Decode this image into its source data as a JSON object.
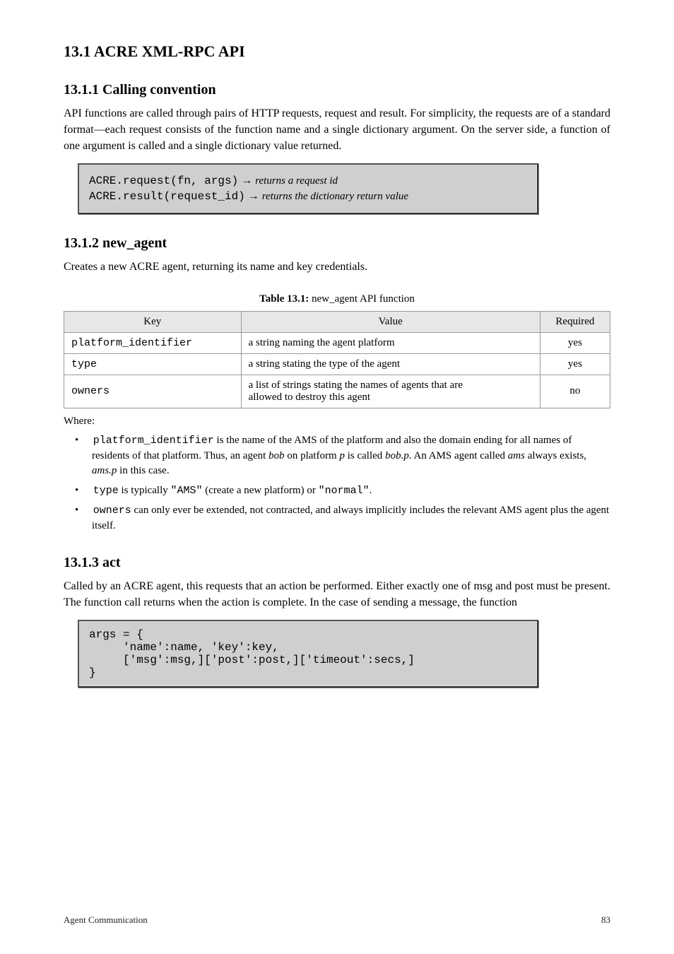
{
  "section_13_1": {
    "title": "13.1 ACRE XML-RPC API",
    "subsections": {
      "calling_convention": {
        "heading": "13.1.1 Calling convention",
        "paragraph": "API functions are called through pairs of HTTP requests, request and result. For simplicity, the requests are of a standard format—each request consists of the function name and a single dictionary argument. On the server side, a function of one argument is called and a single dictionary value returned.",
        "panel": {
          "line1_lhs": "ACRE.request(fn, args)",
          "line1_arrow": "→",
          "line1_rhs": "returns a request id",
          "line2_lhs": "ACRE.result(request_id)",
          "line2_arrow": "→",
          "line2_rhs": "returns the dictionary return value"
        }
      },
      "new_agent": {
        "heading": "13.1.2 new_agent",
        "paragraph": "Creates a new ACRE agent, returning its name and key credentials.",
        "table_caption_label": "Table 13.1:",
        "table_caption_text": "new_agent API function",
        "table": {
          "headers": [
            "Key",
            "Value",
            "Required"
          ],
          "rows": [
            {
              "key": "platform_identifier",
              "value": "a string naming the agent platform",
              "required": "yes"
            },
            {
              "key": "type",
              "value": "a string stating the type of the agent",
              "required": "yes"
            },
            {
              "key": "owners",
              "value_line1": "a list of strings stating the names of agents that are",
              "value_line2": "allowed to destroy this agent",
              "required": "no"
            }
          ]
        },
        "where": {
          "intro": "Where:",
          "items": [
            {
              "lead_code": "platform_identifier",
              "text": " is the name of the AMS of the platform and also the domain ending for all names of residents of that platform. Thus, an agent ",
              "ital1": "bob",
              "text2": " on platform ",
              "ital2": "p",
              "text3": " is called ",
              "ital3": "bob.p",
              "text4": ". An AMS agent called ",
              "ital4": "ams",
              "text5": " always exists, ",
              "ital5": "ams.p",
              "text6": " in this case."
            },
            {
              "lead_code": "type",
              "text": " is typically ",
              "code": "\"AMS\"",
              "text2": " (create a new platform) or ",
              "code2": "\"normal\"",
              "text3": "."
            },
            {
              "lead_code": "owners",
              "text": " can only ever be extended, not contracted, and always implicitly includes the relevant AMS agent plus the agent itself."
            }
          ]
        }
      },
      "act": {
        "heading": "13.1.3 act",
        "paragraph": "Called by an ACRE agent, this requests that an action be performed. Either exactly one of msg and post must be present. The function call returns when the action is complete. In the case of sending a message, the function",
        "panel": {
          "prefix": "args = {",
          "line1": "'name':name, 'key':key,",
          "line2": "['msg':msg,]['post':post,]['timeout':secs,]",
          "suffix": "}"
        }
      }
    }
  },
  "footer": {
    "left": "Agent Communication",
    "right": "83"
  }
}
